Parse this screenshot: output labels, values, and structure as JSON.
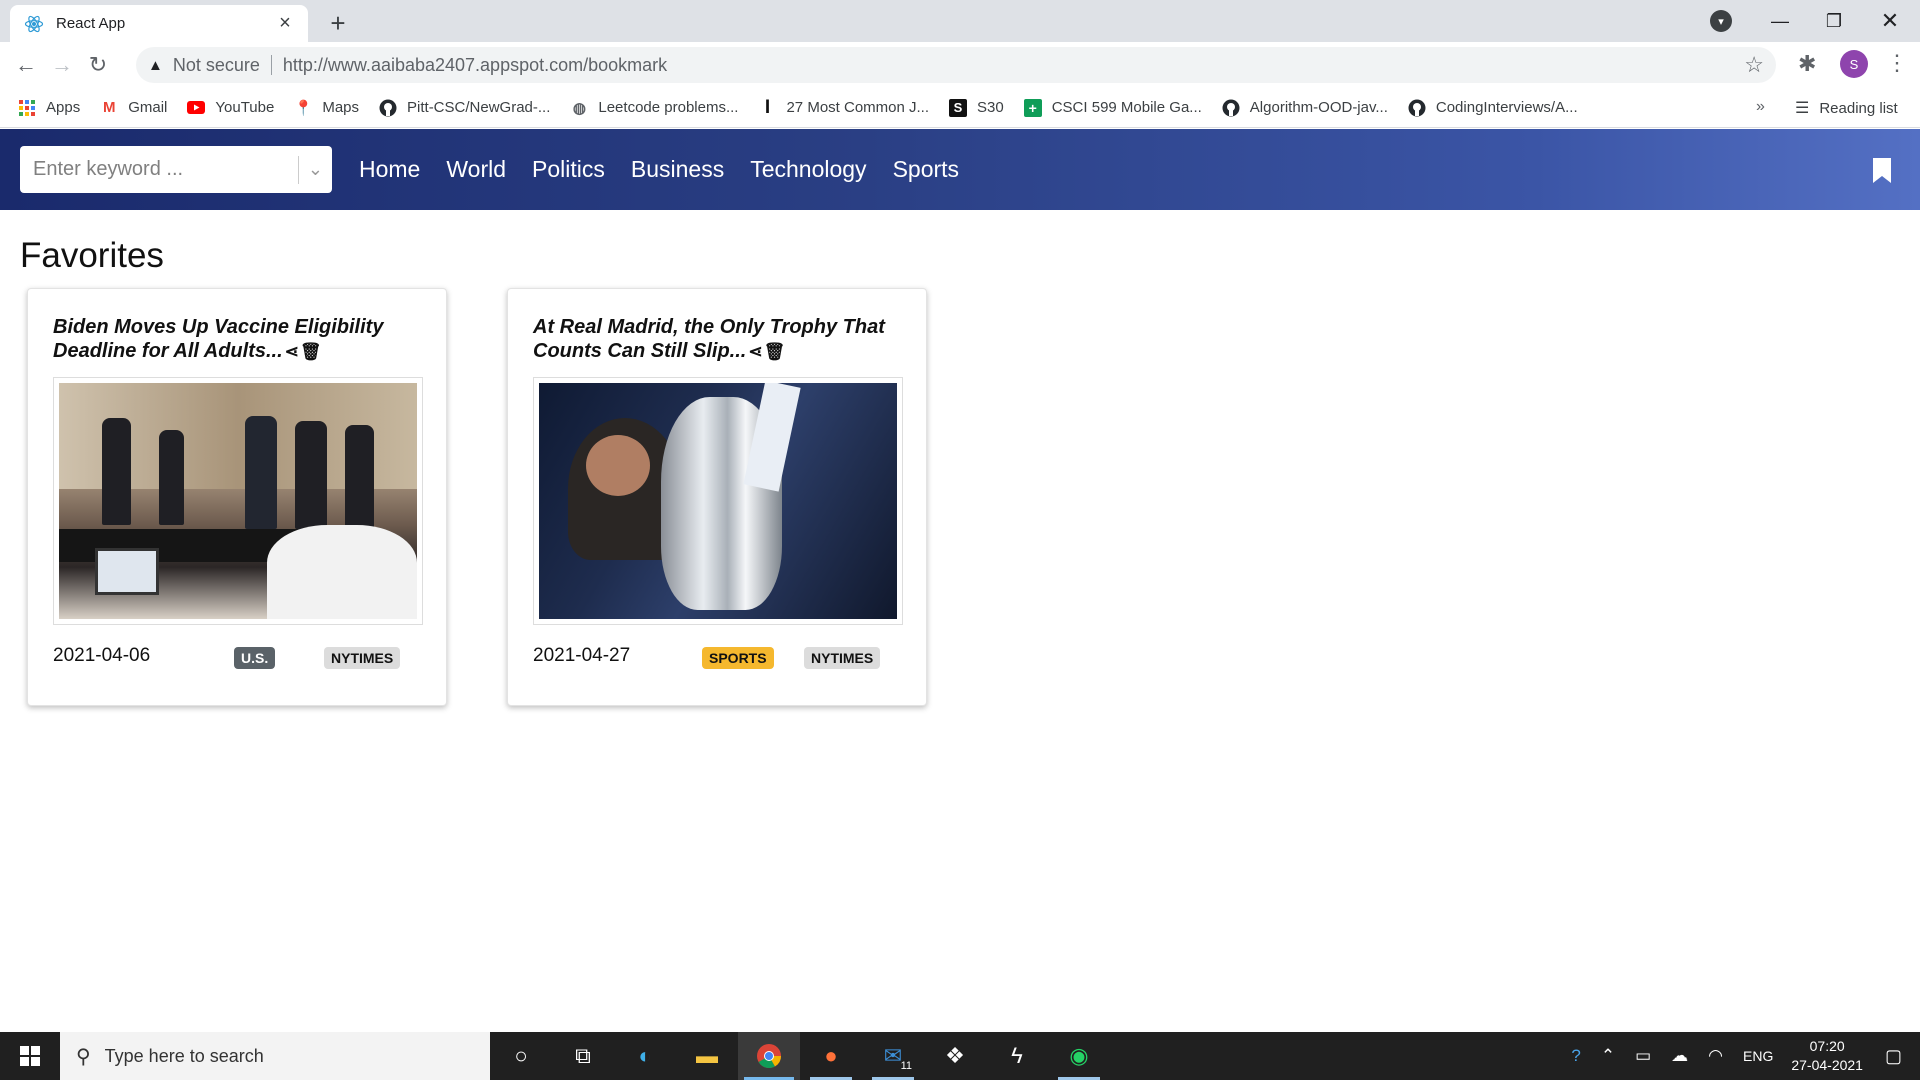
{
  "browser": {
    "tab_title": "React App",
    "tab_icon": "react-icon",
    "security_label": "Not secure",
    "url": "http://www.aaibaba2407.appspot.com/bookmark",
    "profile_initial": "S",
    "bookmarks": [
      {
        "label": "Apps",
        "icon": "apps-grid-icon"
      },
      {
        "label": "Gmail",
        "icon": "gmail-icon"
      },
      {
        "label": "YouTube",
        "icon": "youtube-icon"
      },
      {
        "label": "Maps",
        "icon": "maps-pin-icon"
      },
      {
        "label": "Pitt-CSC/NewGrad-...",
        "icon": "github-icon"
      },
      {
        "label": "Leetcode problems...",
        "icon": "globe-icon"
      },
      {
        "label": "27 Most Common J...",
        "icon": "indeed-icon"
      },
      {
        "label": "S30",
        "icon": "s30-icon"
      },
      {
        "label": "CSCI 599 Mobile Ga...",
        "icon": "sheets-icon"
      },
      {
        "label": "Algorithm-OOD-jav...",
        "icon": "github-icon"
      },
      {
        "label": "CodingInterviews/A...",
        "icon": "github-icon"
      }
    ],
    "reading_list": "Reading list"
  },
  "app": {
    "search_placeholder": "Enter keyword ...",
    "nav": [
      "Home",
      "World",
      "Politics",
      "Business",
      "Technology",
      "Sports"
    ],
    "page_title": "Favorites",
    "cards": [
      {
        "headline": "Biden Moves Up Vaccine Eligibility Deadline for All Adults...",
        "date": "2021-04-06",
        "section": "U.S.",
        "section_color": "#5a6268",
        "source": "NYTIMES"
      },
      {
        "headline": "At Real Madrid, the Only Trophy That Counts Can Still Slip...",
        "date": "2021-04-27",
        "section": "SPORTS",
        "section_color": "#f5b82e",
        "source": "NYTIMES"
      }
    ]
  },
  "taskbar": {
    "search_placeholder": "Type here to search",
    "mail_badge": "11",
    "language": "ENG",
    "time": "07:20",
    "date": "27-04-2021"
  }
}
